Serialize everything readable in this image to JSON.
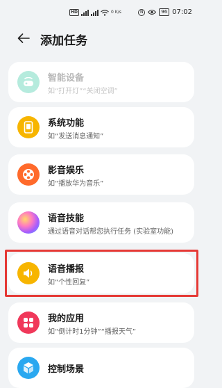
{
  "status_bar": {
    "speed": "0 K/s",
    "battery": "96",
    "time": "07:02"
  },
  "header": {
    "title": "添加任务"
  },
  "tasks": [
    {
      "title": "智能设备",
      "subtitle": "如“打开灯”“关闭空调”",
      "icon": "smart-device-icon",
      "color": "#2ec7a0",
      "enabled": false
    },
    {
      "title": "系统功能",
      "subtitle": "如“发送消息通知”",
      "icon": "phone-system-icon",
      "color": "#f7b500",
      "enabled": true
    },
    {
      "title": "影音娱乐",
      "subtitle": "如“播放华为音乐”",
      "icon": "film-reel-icon",
      "color": "#ff6a2b",
      "enabled": true
    },
    {
      "title": "语音技能",
      "subtitle": "通过语音对话帮您执行任务 (实验室功能)",
      "icon": "voice-orb-icon",
      "color": "#a35cff",
      "enabled": true
    },
    {
      "title": "语音播报",
      "subtitle": "如“个性回复”",
      "icon": "speaker-icon",
      "color": "#f7b500",
      "enabled": true
    },
    {
      "title": "我的应用",
      "subtitle": "如“倒计时1分钟”“播报天气”",
      "icon": "apps-grid-icon",
      "color": "#f0385a",
      "enabled": true
    },
    {
      "title": "控制场景",
      "subtitle": "",
      "icon": "scene-cube-icon",
      "color": "#2aa8f0",
      "enabled": true
    }
  ]
}
